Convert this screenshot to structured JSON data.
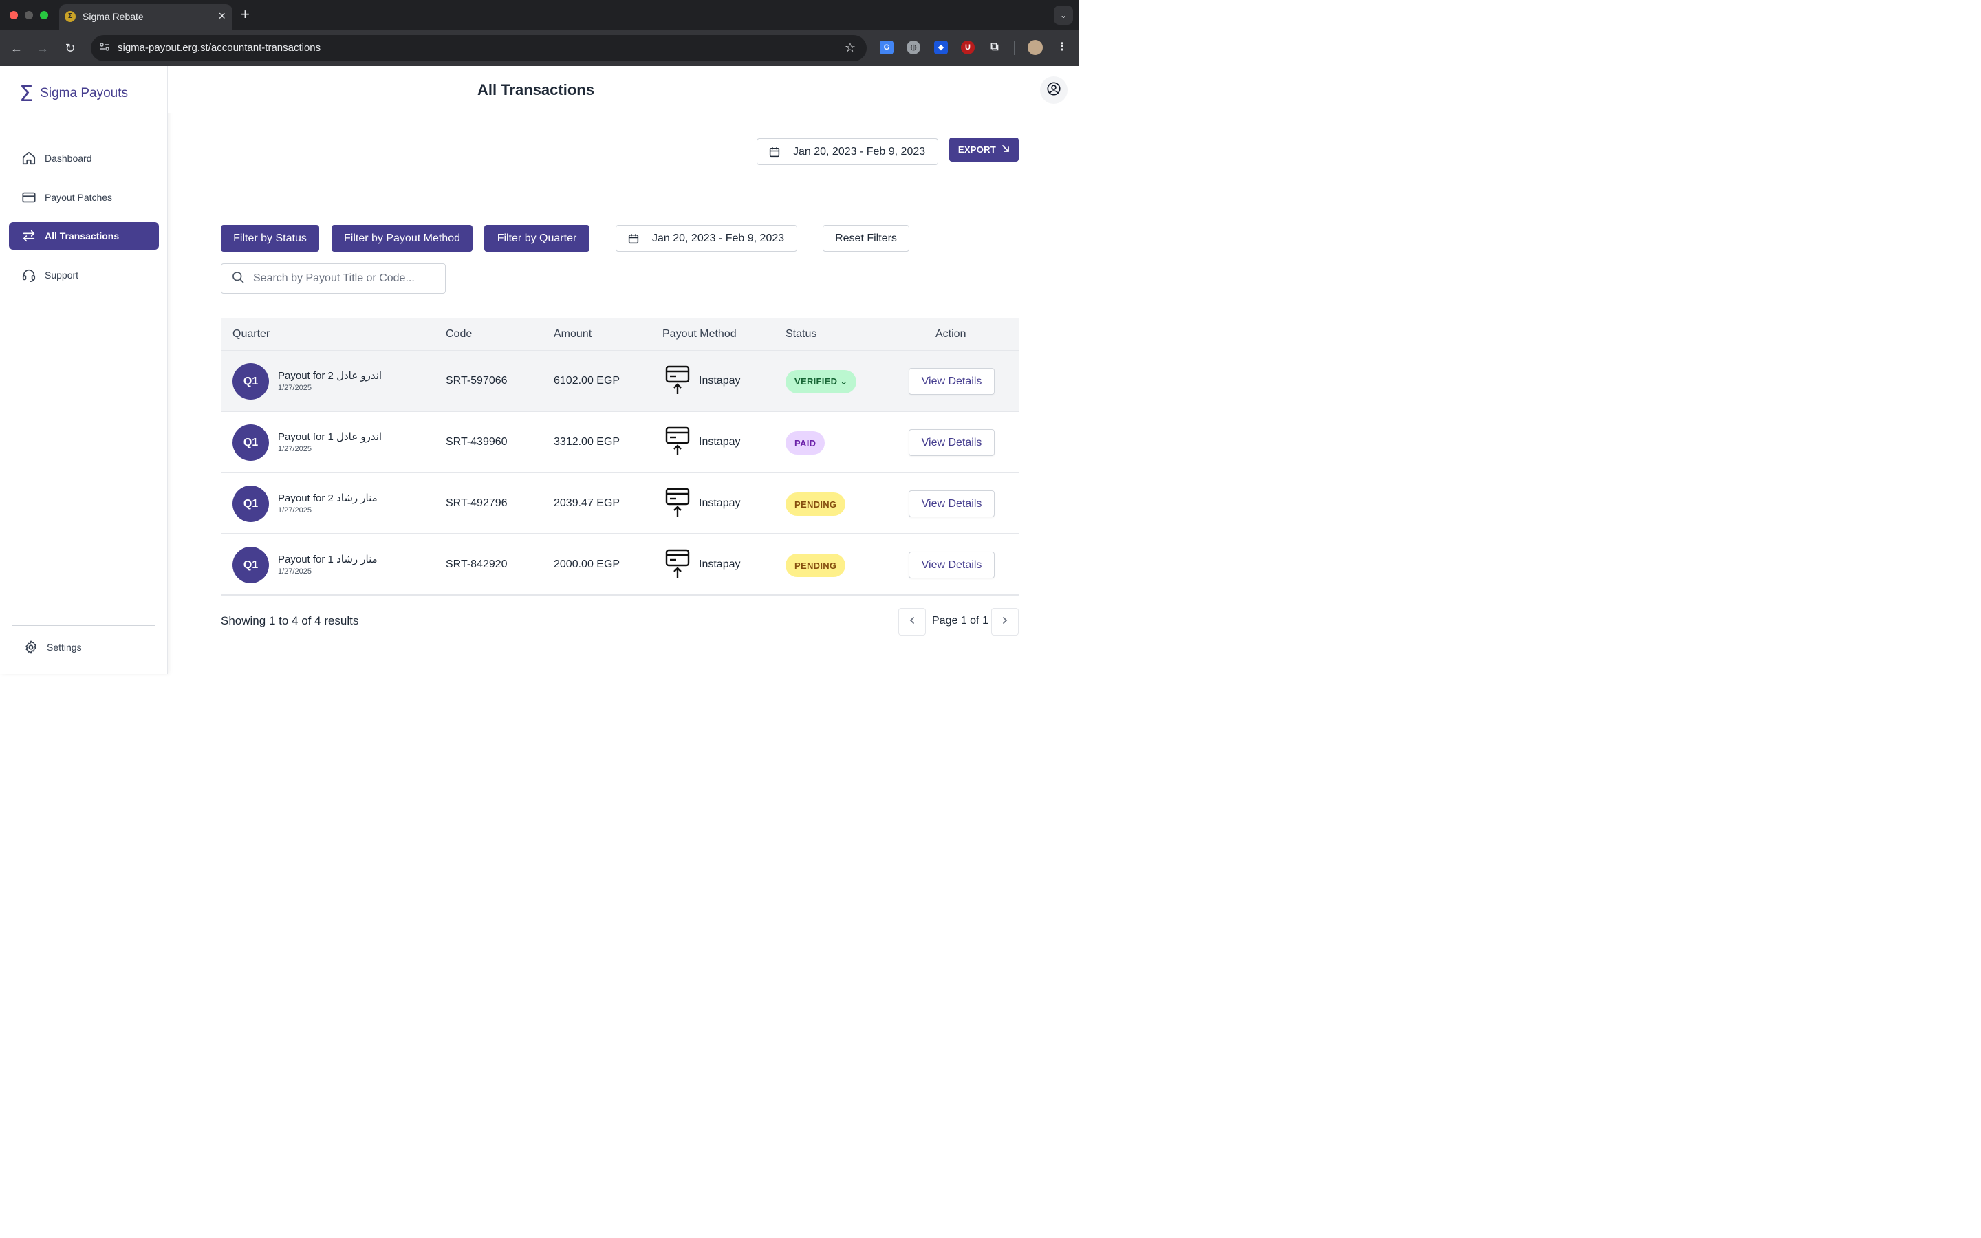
{
  "browser": {
    "tab_title": "Sigma Rebate",
    "favicon_glyph": "Σ",
    "url": "sigma-payout.erg.st/accountant-transactions"
  },
  "brand": {
    "name": "Sigma Payouts",
    "accent_color": "#463e8f"
  },
  "sidebar": {
    "items": [
      {
        "label": "Dashboard",
        "icon": "home-icon"
      },
      {
        "label": "Payout Patches",
        "icon": "card-icon"
      },
      {
        "label": "All Transactions",
        "icon": "arrows-exchange-icon",
        "active": true
      },
      {
        "label": "Support",
        "icon": "headset-icon"
      }
    ],
    "settings_label": "Settings"
  },
  "header": {
    "title": "All Transactions"
  },
  "controls": {
    "date_range_top": "Jan 20, 2023 - Feb 9, 2023",
    "export_label": "EXPORT",
    "filter_status": "Filter by Status",
    "filter_method": "Filter by Payout Method",
    "filter_quarter": "Filter by Quarter",
    "date_range_filter": "Jan 20, 2023 - Feb 9, 2023",
    "reset_filters": "Reset Filters",
    "search_placeholder": "Search by Payout Title or Code..."
  },
  "table": {
    "columns": [
      "Quarter",
      "Code",
      "Amount",
      "Payout Method",
      "Status",
      "Action"
    ],
    "rows": [
      {
        "quarter": "Q1",
        "title": "Payout for 2 اندرو عادل",
        "date": "1/27/2025",
        "code": "SRT-597066",
        "amount": "6102.00 EGP",
        "method": "Instapay",
        "status": "VERIFIED ⌄",
        "action": "View Details"
      },
      {
        "quarter": "Q1",
        "title": "Payout for 1 اندرو عادل",
        "date": "1/27/2025",
        "code": "SRT-439960",
        "amount": "3312.00 EGP",
        "method": "Instapay",
        "status": "PAID",
        "action": "View Details"
      },
      {
        "quarter": "Q1",
        "title": "Payout for 2 منار رشاد",
        "date": "1/27/2025",
        "code": "SRT-492796",
        "amount": "2039.47 EGP",
        "method": "Instapay",
        "status": "PENDING",
        "action": "View Details"
      },
      {
        "quarter": "Q1",
        "title": "Payout for 1 منار رشاد",
        "date": "1/27/2025",
        "code": "SRT-842920",
        "amount": "2000.00 EGP",
        "method": "Instapay",
        "status": "PENDING",
        "action": "View Details"
      }
    ]
  },
  "status_colors": {
    "verified": {
      "bg": "#bbf7d0",
      "fg": "#166534"
    },
    "paid": {
      "bg": "#e9d5ff",
      "fg": "#6b21a8"
    },
    "pending": {
      "bg": "#fef08a",
      "fg": "#854d0e"
    }
  },
  "pagination": {
    "summary_prefix": "Showing ",
    "from": "1",
    "to_word": " to ",
    "to": "4",
    "of_word": " of ",
    "total": "4",
    "suffix": " results",
    "page_label": "Page 1 of 1"
  }
}
